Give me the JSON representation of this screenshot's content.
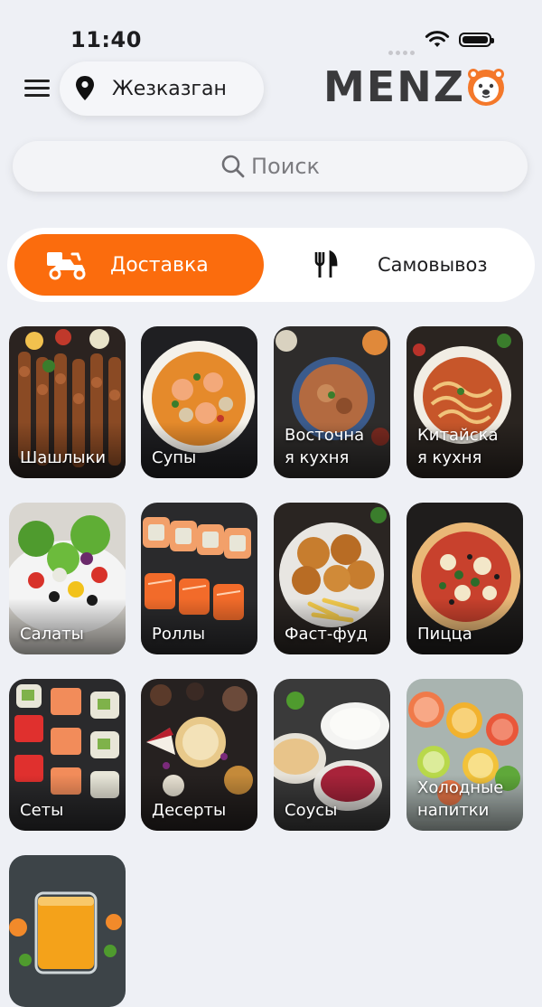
{
  "status_bar": {
    "time": "11:40"
  },
  "header": {
    "city": "Жезказган",
    "logo_text": "MENZ",
    "logo_mascot_icon": "bear-face-icon"
  },
  "search": {
    "placeholder": "Поиск"
  },
  "order_mode": {
    "options": [
      {
        "label": "Доставка",
        "icon": "scooter-icon",
        "selected": true
      },
      {
        "label": "Самовывоз",
        "icon": "cutlery-icon",
        "selected": false
      }
    ]
  },
  "colors": {
    "accent": "#fb6c0d",
    "background": "#eef0f5",
    "text": "#1d1d1f"
  },
  "categories": [
    {
      "label": "Шашлыки",
      "theme": "skewers"
    },
    {
      "label": "Супы",
      "theme": "soup"
    },
    {
      "label": "Восточна\nя кухня",
      "theme": "plov"
    },
    {
      "label": "Китайска\nя кухня",
      "theme": "noodles"
    },
    {
      "label": "Салаты",
      "theme": "salad"
    },
    {
      "label": "Роллы",
      "theme": "rolls"
    },
    {
      "label": "Фаст-фуд",
      "theme": "fastfood"
    },
    {
      "label": "Пицца",
      "theme": "pizza"
    },
    {
      "label": "Сеты",
      "theme": "sushi-set"
    },
    {
      "label": "Десерты",
      "theme": "desserts"
    },
    {
      "label": "Соусы",
      "theme": "sauces"
    },
    {
      "label": "Холодные\nнапитки",
      "theme": "citrus"
    },
    {
      "label": "",
      "theme": "juice"
    }
  ]
}
